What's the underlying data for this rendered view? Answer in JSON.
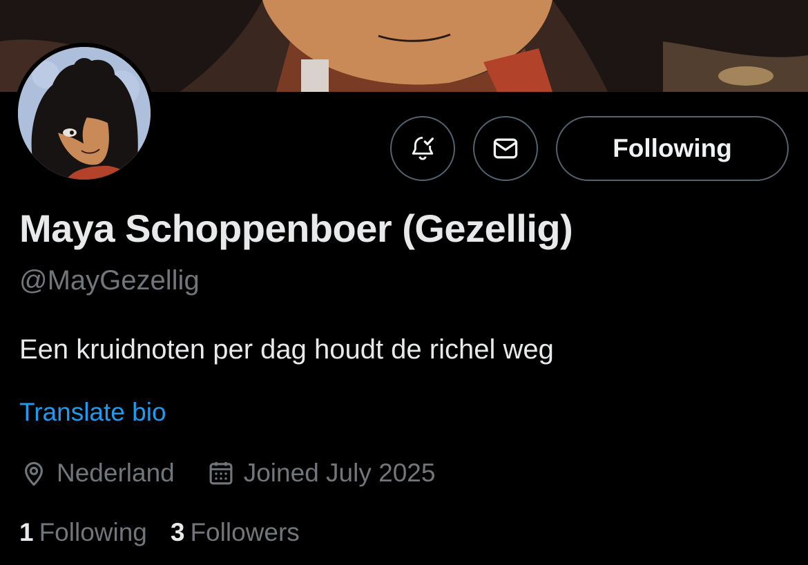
{
  "profile": {
    "display_name": "Maya Schoppenboer (Gezellig)",
    "handle": "@MayGezellig",
    "bio": "Een kruidnoten per dag houdt de richel weg",
    "translate_label": "Translate bio",
    "location": "Nederland",
    "joined": "Joined July 2025"
  },
  "actions": {
    "notify_icon": "bell-check-icon",
    "message_icon": "envelope-icon",
    "follow_label": "Following"
  },
  "stats": {
    "following_count": "1",
    "following_label": "Following",
    "followers_count": "3",
    "followers_label": "Followers"
  },
  "icons": {
    "location": "location-pin-icon",
    "calendar": "calendar-icon"
  },
  "colors": {
    "background": "#000000",
    "text_primary": "#e7e9ea",
    "text_secondary": "#71767b",
    "link": "#1d9bf0",
    "border": "#536471"
  }
}
